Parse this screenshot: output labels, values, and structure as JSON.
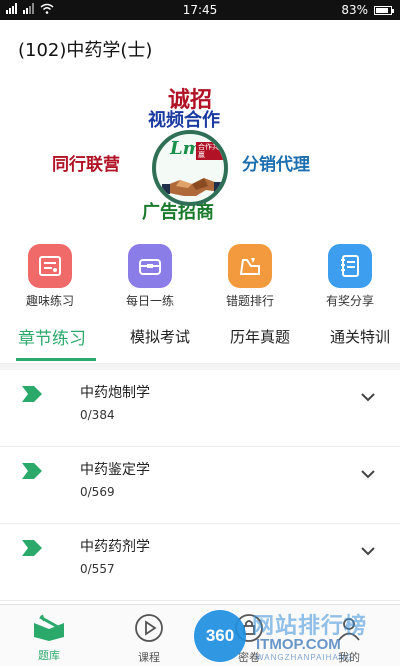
{
  "status_bar": {
    "time": "17:45",
    "battery": "83%"
  },
  "header": {
    "title": "(102)中药学(士)"
  },
  "banner": {
    "headline": "诚招",
    "subline": "视频合作",
    "left": "同行联营",
    "right": "分销代理",
    "bottom": "广告招商",
    "logo_mark": "Lm",
    "logo_tag": "合作共赢"
  },
  "quick_menu": [
    {
      "label": "趣味练习",
      "icon": "practice-list-icon",
      "color": "#f06a6a"
    },
    {
      "label": "每日一练",
      "icon": "daily-box-icon",
      "color": "#8b7de8"
    },
    {
      "label": "错题排行",
      "icon": "wrong-ranking-icon",
      "color": "#f29a3d"
    },
    {
      "label": "有奖分享",
      "icon": "share-notebook-icon",
      "color": "#3d9ef0"
    }
  ],
  "tabs": [
    {
      "label": "章节练习",
      "active": true
    },
    {
      "label": "模拟考试",
      "active": false
    },
    {
      "label": "历年真题",
      "active": false
    },
    {
      "label": "通关特训",
      "active": false
    }
  ],
  "chapters": [
    {
      "name": "中药炮制学",
      "progress": "0/384"
    },
    {
      "name": "中药鉴定学",
      "progress": "0/569"
    },
    {
      "name": "中药药剂学",
      "progress": "0/557"
    }
  ],
  "bottom_nav": [
    {
      "label": "题库",
      "active": true
    },
    {
      "label": "课程",
      "active": false
    },
    {
      "label": "密卷",
      "active": false
    },
    {
      "label": "我的",
      "active": false
    }
  ],
  "watermark": {
    "badge": "360",
    "cn": "网站排行榜",
    "en": "ITMOP.COM",
    "sub": "WANGZHANPAIHANG"
  },
  "colors": {
    "accent": "#2aa96b"
  }
}
